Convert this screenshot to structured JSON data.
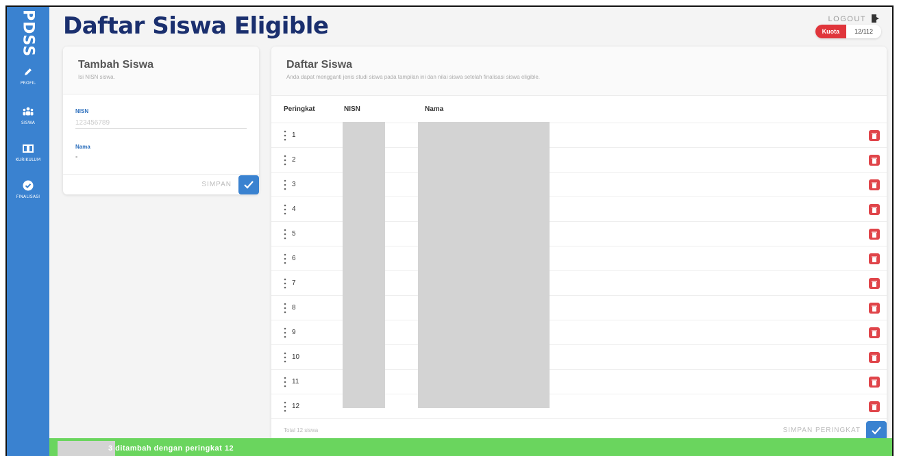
{
  "brand": "PDSS",
  "sidebar": {
    "items": [
      {
        "label": "PROFIL",
        "icon": "pencil-icon"
      },
      {
        "label": "SISWA",
        "icon": "users-icon"
      },
      {
        "label": "KURIKULUM",
        "icon": "book-icon"
      },
      {
        "label": "FINALISASI",
        "icon": "check-circle-icon"
      }
    ]
  },
  "header": {
    "title": "Daftar Siswa Eligible",
    "logout_label": "LOGOUT",
    "quota_label": "Kuota",
    "quota_value": "12/112"
  },
  "add_form": {
    "title": "Tambah Siswa",
    "subtitle": "Isi NISN siswa.",
    "nisn_label": "NISN",
    "nisn_placeholder": "123456789",
    "nama_label": "Nama",
    "nama_value": "-",
    "save_label": "SIMPAN"
  },
  "list": {
    "title": "Daftar Siswa",
    "subtitle": "Anda dapat mengganti jenis studi siswa pada tampilan ini dan nilai siswa setelah finalisasi siswa eligible.",
    "columns": [
      "Peringkat",
      "NISN",
      "Nama"
    ],
    "ranks": [
      "1",
      "2",
      "3",
      "4",
      "5",
      "6",
      "7",
      "8",
      "9",
      "10",
      "11",
      "12"
    ],
    "total": "Total 12 siswa",
    "save_label": "SIMPAN PERINGKAT"
  },
  "toast": {
    "message": "3 ditambah dengan peringkat 12"
  },
  "colors": {
    "sidebar": "#3a82d0",
    "title": "#1a2f6e",
    "danger": "#e0454a",
    "toast": "#6ad55e"
  }
}
